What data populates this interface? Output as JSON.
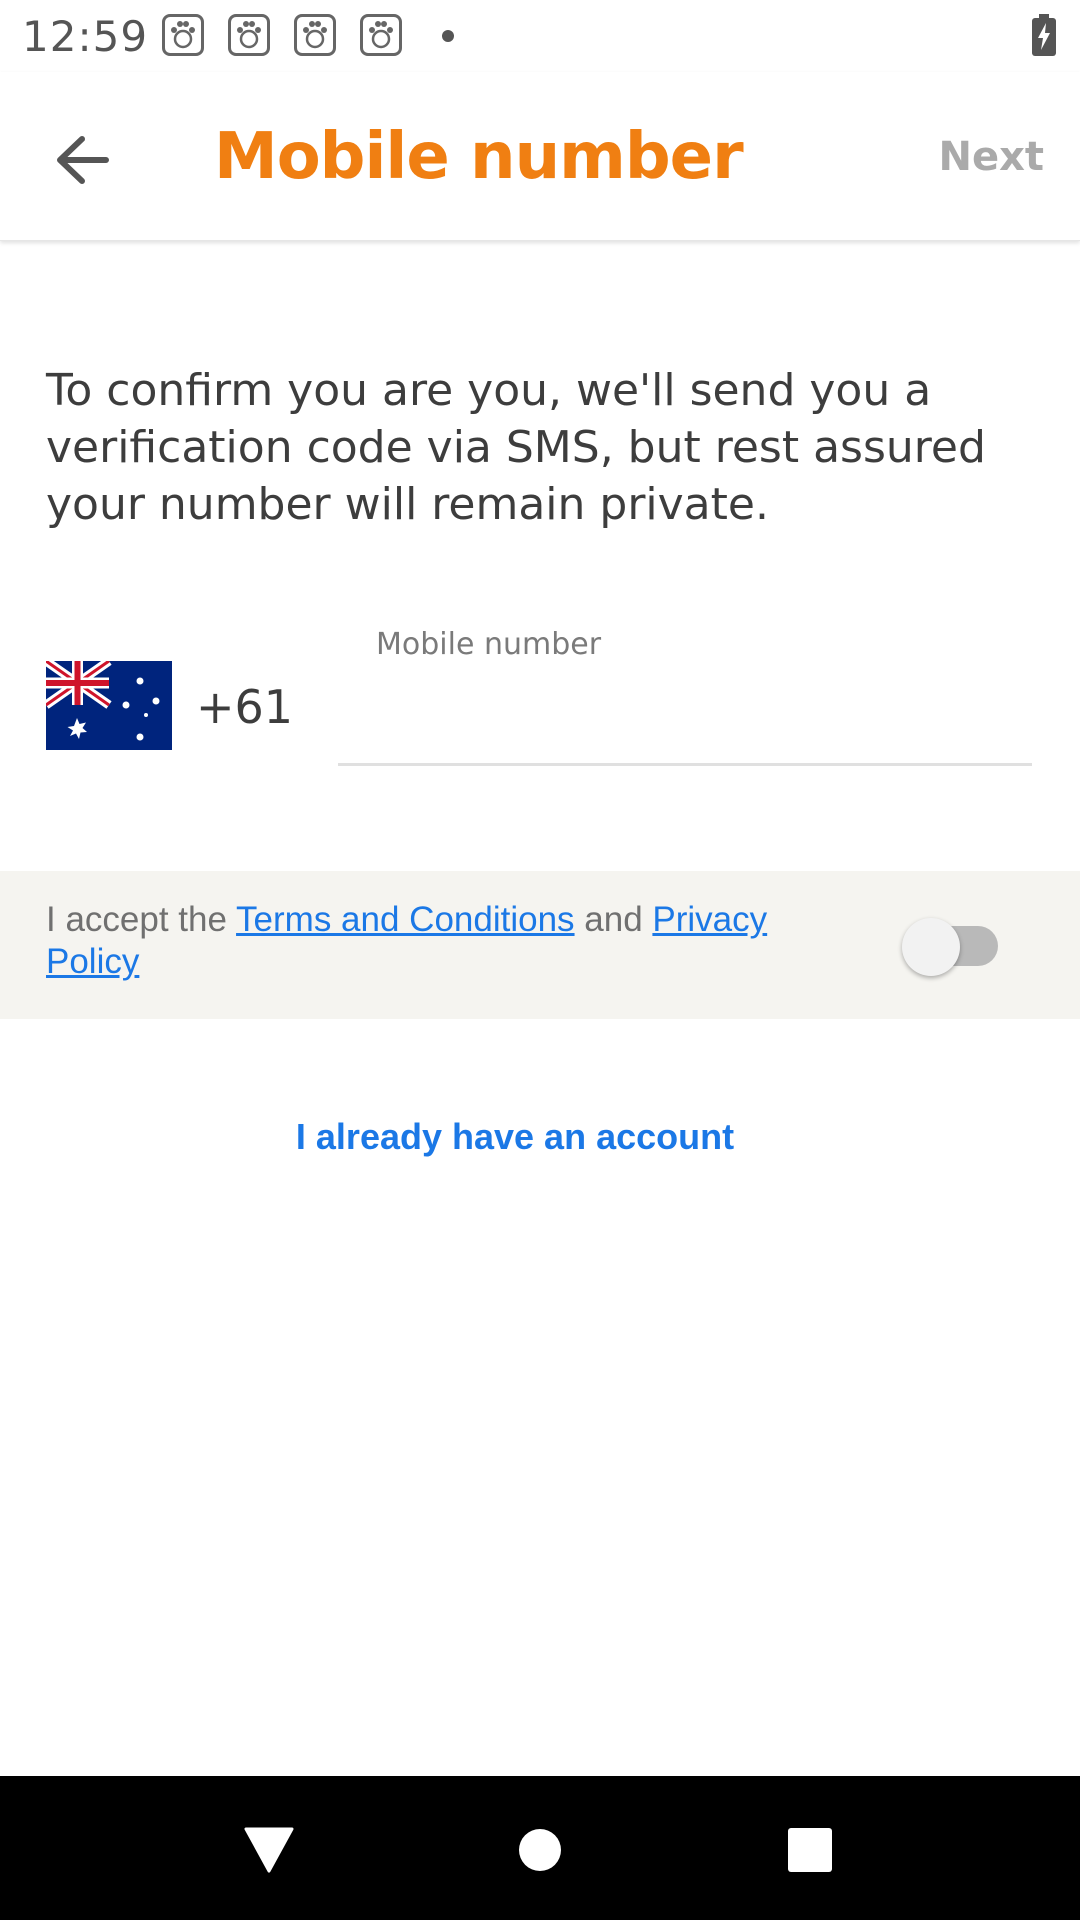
{
  "status_bar": {
    "time": "12:59",
    "notification_icons": [
      "baidu-icon",
      "baidu-icon",
      "baidu-icon",
      "baidu-icon"
    ],
    "battery_icon": "battery-charging-icon"
  },
  "app_bar": {
    "back_icon": "arrow-left-icon",
    "title": "Mobile number",
    "next_label": "Next"
  },
  "intro": {
    "text": "To confirm you are you, we'll send you a verification code via SMS, but rest assured your number will remain private."
  },
  "phone": {
    "flag_icon": "australia-flag-icon",
    "country_code": "+61",
    "field_label": "Mobile number",
    "value": ""
  },
  "terms": {
    "prefix": "I accept the ",
    "terms_link": "Terms and Conditions",
    "middle": " and ",
    "privacy_link": "Privacy Policy",
    "toggle_on": false
  },
  "account_link": "I already have an account",
  "nav_bar": {
    "back_icon": "triangle-back-icon",
    "home_icon": "circle-home-icon",
    "recents_icon": "square-recents-icon"
  },
  "colors": {
    "accent": "#f07f12",
    "link": "#1b78e6",
    "disabled": "#aaaaaa",
    "terms_bg": "#f5f4f0"
  }
}
